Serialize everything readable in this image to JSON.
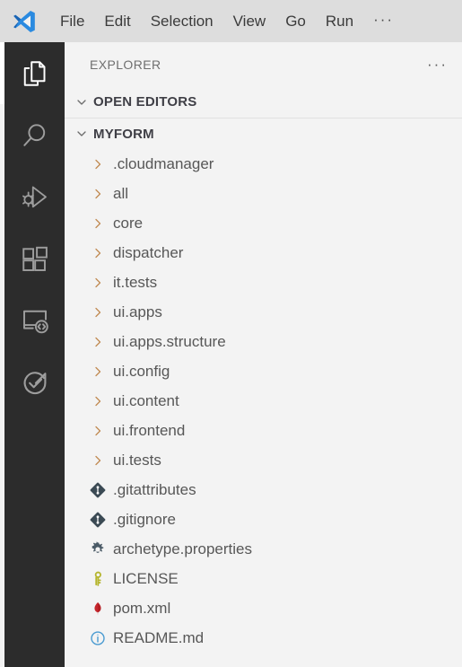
{
  "app": {
    "logo_icon": "vscode-logo-icon",
    "title": "Visual Studio Code"
  },
  "menubar": {
    "items": [
      {
        "label": "File",
        "name": "menu-file"
      },
      {
        "label": "Edit",
        "name": "menu-edit"
      },
      {
        "label": "Selection",
        "name": "menu-selection"
      },
      {
        "label": "View",
        "name": "menu-view"
      },
      {
        "label": "Go",
        "name": "menu-go"
      },
      {
        "label": "Run",
        "name": "menu-run"
      }
    ],
    "overflow": "···"
  },
  "activitybar": {
    "items": [
      {
        "label": "Explorer",
        "icon": "files-icon",
        "active": true
      },
      {
        "label": "Search",
        "icon": "search-icon",
        "active": false
      },
      {
        "label": "Run and Debug",
        "icon": "run-and-debug-icon",
        "active": false
      },
      {
        "label": "Extensions",
        "icon": "extensions-icon",
        "active": false
      },
      {
        "label": "Remote Explorer",
        "icon": "remote-explorer-icon",
        "active": false
      },
      {
        "label": "Testing",
        "icon": "testing-icon",
        "active": false
      }
    ]
  },
  "explorer": {
    "title": "EXPLORER",
    "actions_label": "···",
    "sections": [
      {
        "label": "OPEN EDITORS",
        "expanded": true
      },
      {
        "label": "MYFORM",
        "expanded": true
      }
    ],
    "tree": [
      {
        "label": ".cloudmanager",
        "type": "folder",
        "icon": "chevron-right-icon",
        "expanded": false
      },
      {
        "label": "all",
        "type": "folder",
        "icon": "chevron-right-icon",
        "expanded": false
      },
      {
        "label": "core",
        "type": "folder",
        "icon": "chevron-right-icon",
        "expanded": false
      },
      {
        "label": "dispatcher",
        "type": "folder",
        "icon": "chevron-right-icon",
        "expanded": false
      },
      {
        "label": "it.tests",
        "type": "folder",
        "icon": "chevron-right-icon",
        "expanded": false
      },
      {
        "label": "ui.apps",
        "type": "folder",
        "icon": "chevron-right-icon",
        "expanded": false
      },
      {
        "label": "ui.apps.structure",
        "type": "folder",
        "icon": "chevron-right-icon",
        "expanded": false
      },
      {
        "label": "ui.config",
        "type": "folder",
        "icon": "chevron-right-icon",
        "expanded": false
      },
      {
        "label": "ui.content",
        "type": "folder",
        "icon": "chevron-right-icon",
        "expanded": false
      },
      {
        "label": "ui.frontend",
        "type": "folder",
        "icon": "chevron-right-icon",
        "expanded": false
      },
      {
        "label": "ui.tests",
        "type": "folder",
        "icon": "chevron-right-icon",
        "expanded": false
      },
      {
        "label": ".gitattributes",
        "type": "file",
        "icon": "git-file-icon"
      },
      {
        "label": ".gitignore",
        "type": "file",
        "icon": "git-file-icon"
      },
      {
        "label": "archetype.properties",
        "type": "file",
        "icon": "gear-settings-icon"
      },
      {
        "label": "LICENSE",
        "type": "file",
        "icon": "key-license-icon"
      },
      {
        "label": "pom.xml",
        "type": "file",
        "icon": "maven-pom-icon"
      },
      {
        "label": "README.md",
        "type": "file",
        "icon": "info-readme-icon"
      }
    ]
  },
  "colors": {
    "menubar_bg": "#dddddd",
    "activitybar_bg": "#2c2c2c",
    "sidebar_bg": "#f3f3f3",
    "text": "#575757",
    "section_text": "#3f3f46",
    "chevron": "#c08a52",
    "accent_blue": "#0078d4",
    "git_icon": "#3b4a54",
    "license_icon": "#b5b52d",
    "maven_icon": "#c5262c",
    "readme_icon": "#4a9bd1",
    "active_indicator": "#ffffff"
  }
}
